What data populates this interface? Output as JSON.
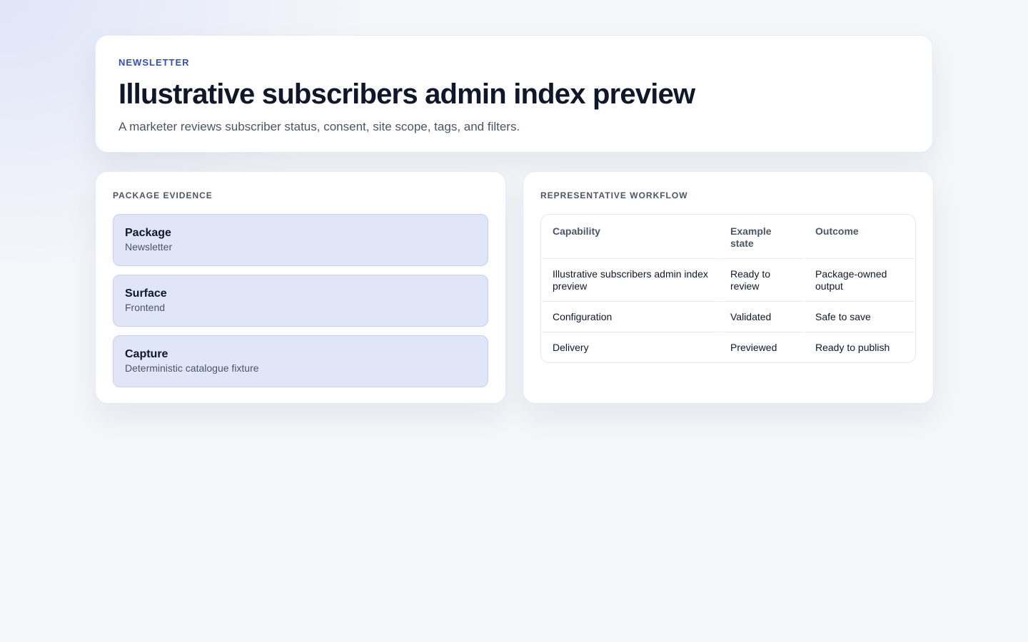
{
  "header": {
    "eyebrow": "NEWSLETTER",
    "title": "Illustrative subscribers admin index preview",
    "subtitle": "A marketer reviews subscriber status, consent, site scope, tags, and filters."
  },
  "evidence": {
    "heading": "PACKAGE EVIDENCE",
    "items": [
      {
        "label": "Package",
        "value": "Newsletter"
      },
      {
        "label": "Surface",
        "value": "Frontend"
      },
      {
        "label": "Capture",
        "value": "Deterministic catalogue fixture"
      }
    ]
  },
  "workflow": {
    "heading": "REPRESENTATIVE WORKFLOW",
    "columns": [
      "Capability",
      "Example state",
      "Outcome"
    ],
    "rows": [
      [
        "Illustrative subscribers admin index preview",
        "Ready to review",
        "Package-owned output"
      ],
      [
        "Configuration",
        "Validated",
        "Safe to save"
      ],
      [
        "Delivery",
        "Previewed",
        "Ready to publish"
      ]
    ]
  }
}
